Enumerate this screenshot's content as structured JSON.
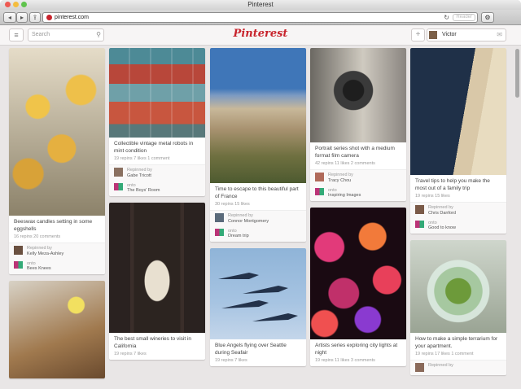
{
  "window": {
    "title": "Pinterest"
  },
  "browser": {
    "url": "pinterest.com",
    "reader_label": "Reader"
  },
  "header": {
    "search_placeholder": "Search",
    "logo": "Pinterest",
    "user_name": "Victor"
  },
  "pins": [
    {
      "desc": "Beeswax candles setting in some eggshells",
      "stats": "16 repins   20 comments",
      "repinned_label": "Repinned by",
      "repinned_by": "Kelly Meza-Ashley",
      "onto_label": "onto",
      "onto": "Bees Knees"
    },
    {
      "desc": "",
      "stats": "",
      "repinned_label": "",
      "repinned_by": "",
      "onto_label": "",
      "onto": ""
    },
    {
      "desc": "Collectible vintage metal robots in mint condition",
      "stats": "19 repins   7 likes   1 comment",
      "repinned_label": "Repinned by",
      "repinned_by": "Gabe Tricott",
      "onto_label": "onto",
      "onto": "The Boys' Room"
    },
    {
      "desc": "The best small wineries to visit in California",
      "stats": "19 repins   7 likes",
      "repinned_label": "",
      "repinned_by": "",
      "onto_label": "",
      "onto": ""
    },
    {
      "desc": "Time to escape to this beautiful part of France",
      "stats": "30 repins   15 likes",
      "repinned_label": "Repinned by",
      "repinned_by": "Connor Montgomery",
      "onto_label": "onto",
      "onto": "Dream trip"
    },
    {
      "desc": "Blue Angels flying over Seattle during Seafair",
      "stats": "19 repins   7 likes",
      "repinned_label": "",
      "repinned_by": "",
      "onto_label": "",
      "onto": ""
    },
    {
      "desc": "Portrait series shot with a medium format film camera",
      "stats": "42 repins   11 likes   2 comments",
      "repinned_label": "Repinned by",
      "repinned_by": "Tracy Chou",
      "onto_label": "onto",
      "onto": "Inspiring Images"
    },
    {
      "desc": "Artists series exploring city lights at night",
      "stats": "19 repins   11 likes   3 comments",
      "repinned_label": "",
      "repinned_by": "",
      "onto_label": "",
      "onto": ""
    },
    {
      "desc": "Travel tips to help you make the most out of a family trip",
      "stats": "19 repins   15 likes",
      "repinned_label": "Repinned by",
      "repinned_by": "Chris Danford",
      "onto_label": "onto",
      "onto": "Good to know"
    },
    {
      "desc": "How to make a simple terrarium for your apartment.",
      "stats": "19 repins   17 likes   1 comment",
      "repinned_label": "Repinned by",
      "repinned_by": "",
      "onto_label": "",
      "onto": ""
    }
  ],
  "colors": {
    "brand": "#c8232c",
    "board_bg": "#e9e6e6"
  }
}
